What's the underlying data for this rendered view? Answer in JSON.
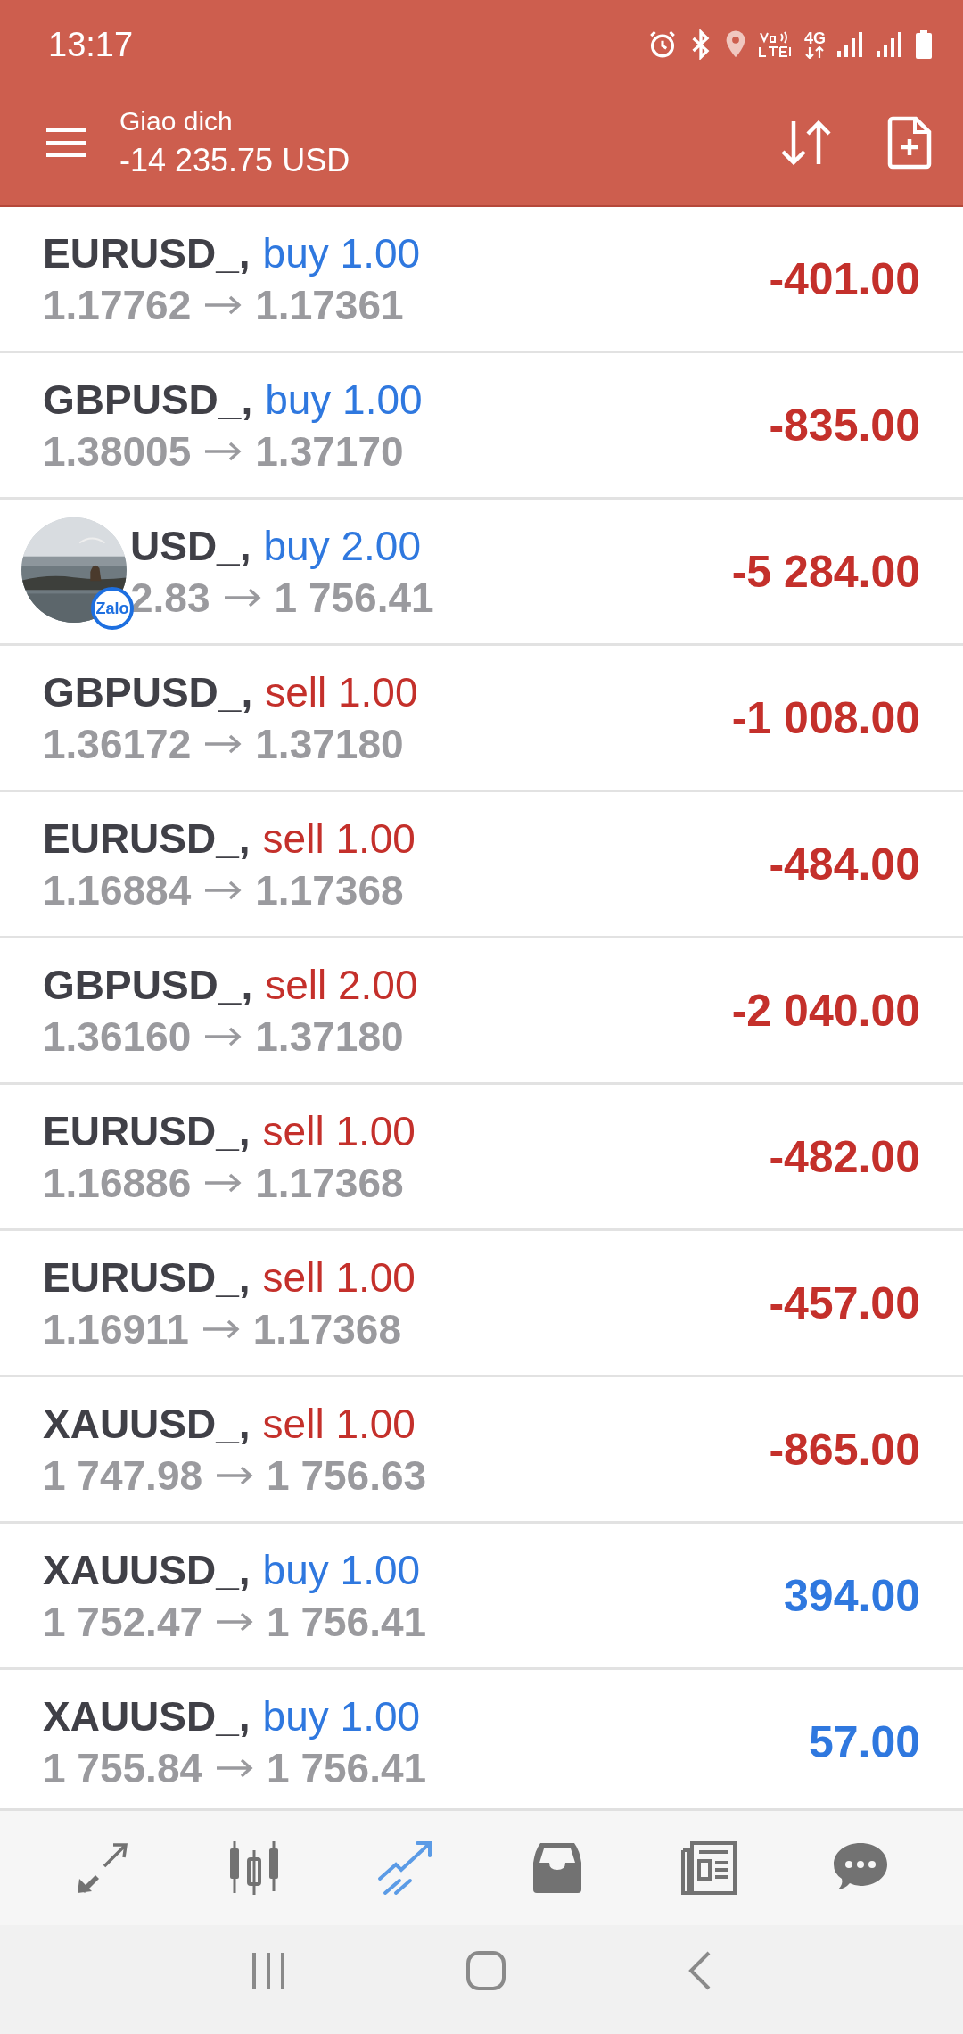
{
  "status_bar": {
    "time": "13:17",
    "network_label": "4G"
  },
  "header": {
    "title": "Giao dich",
    "balance": "-14 235.75 USD"
  },
  "positions": [
    {
      "symbol": "EURUSD_,",
      "kind": "buy",
      "side": "buy",
      "volume": "1.00",
      "open_price": "1.17762",
      "current_price": "1.17361",
      "profit": "-401.00",
      "loss": true
    },
    {
      "symbol": "GBPUSD_,",
      "kind": "buy",
      "side": "buy",
      "volume": "1.00",
      "open_price": "1.38005",
      "current_price": "1.37170",
      "profit": "-835.00",
      "loss": true
    },
    {
      "symbol": "USD_,",
      "kind": "buy",
      "side": "buy",
      "volume": "2.00",
      "open_price": "2.83",
      "current_price": "1 756.41",
      "profit": "-5 284.00",
      "loss": true,
      "overlay": {
        "kind": "chat_head",
        "badge": "Zalo"
      }
    },
    {
      "symbol": "GBPUSD_,",
      "kind": "sell",
      "side": "sell",
      "volume": "1.00",
      "open_price": "1.36172",
      "current_price": "1.37180",
      "profit": "-1 008.00",
      "loss": true
    },
    {
      "symbol": "EURUSD_,",
      "kind": "sell",
      "side": "sell",
      "volume": "1.00",
      "open_price": "1.16884",
      "current_price": "1.17368",
      "profit": "-484.00",
      "loss": true
    },
    {
      "symbol": "GBPUSD_,",
      "kind": "sell",
      "side": "sell",
      "volume": "2.00",
      "open_price": "1.36160",
      "current_price": "1.37180",
      "profit": "-2 040.00",
      "loss": true
    },
    {
      "symbol": "EURUSD_,",
      "kind": "sell",
      "side": "sell",
      "volume": "1.00",
      "open_price": "1.16886",
      "current_price": "1.17368",
      "profit": "-482.00",
      "loss": true
    },
    {
      "symbol": "EURUSD_,",
      "kind": "sell",
      "side": "sell",
      "volume": "1.00",
      "open_price": "1.16911",
      "current_price": "1.17368",
      "profit": "-457.00",
      "loss": true
    },
    {
      "symbol": "XAUUSD_,",
      "kind": "sell",
      "side": "sell",
      "volume": "1.00",
      "open_price": "1 747.98",
      "current_price": "1 756.63",
      "profit": "-865.00",
      "loss": true
    },
    {
      "symbol": "XAUUSD_,",
      "kind": "buy",
      "side": "buy",
      "volume": "1.00",
      "open_price": "1 752.47",
      "current_price": "1 756.41",
      "profit": "394.00",
      "loss": false
    },
    {
      "symbol": "XAUUSD_,",
      "kind": "buy",
      "side": "buy",
      "volume": "1.00",
      "open_price": "1 755.84",
      "current_price": "1 756.41",
      "profit": "57.00",
      "loss": false
    }
  ],
  "bottom_nav": [
    {
      "kind": "quotes",
      "selected": false
    },
    {
      "kind": "chart",
      "selected": false
    },
    {
      "kind": "trade",
      "selected": true
    },
    {
      "kind": "history",
      "selected": false
    },
    {
      "kind": "news",
      "selected": false
    },
    {
      "kind": "chat",
      "selected": false
    }
  ]
}
